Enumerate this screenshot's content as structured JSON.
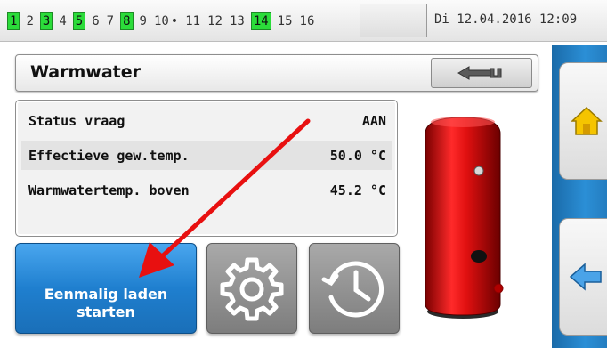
{
  "status_bar": {
    "outputs": [
      {
        "label": "1",
        "active": true
      },
      {
        "label": "2",
        "active": false
      },
      {
        "label": "3",
        "active": true
      },
      {
        "label": "4",
        "active": false
      },
      {
        "label": "5",
        "active": true
      },
      {
        "label": "6",
        "active": false
      },
      {
        "label": "7",
        "active": false
      },
      {
        "label": "8",
        "active": true
      },
      {
        "label": "9",
        "active": false
      },
      {
        "label": "10",
        "active": false
      },
      {
        "label": "11",
        "active": false
      },
      {
        "label": "12",
        "active": false
      },
      {
        "label": "13",
        "active": false
      },
      {
        "label": "14",
        "active": true
      },
      {
        "label": "15",
        "active": false
      },
      {
        "label": "16",
        "active": false
      }
    ],
    "datetime": "Di  12.04.2016  12:09"
  },
  "page": {
    "title": "Warmwater"
  },
  "values": [
    {
      "label": "Status vraag",
      "value": "AAN"
    },
    {
      "label": "Effectieve gew.temp.",
      "value": "50.0 °C"
    },
    {
      "label": "Warmwatertemp. boven",
      "value": "45.2 °C"
    }
  ],
  "actions": {
    "start_button_label": "Eenmalig laden starten"
  },
  "icons": {
    "home": "home-icon",
    "back": "back-arrow-icon",
    "settings": "gear-icon",
    "timer": "clock-history-icon",
    "tank": "hot-water-tank-image"
  },
  "colors": {
    "active_output": "#2bdc3a",
    "primary_button": "#1f7fcf",
    "sidebar": "#2b8fd6",
    "tank": "#e01010",
    "annotation": "#e81010"
  }
}
